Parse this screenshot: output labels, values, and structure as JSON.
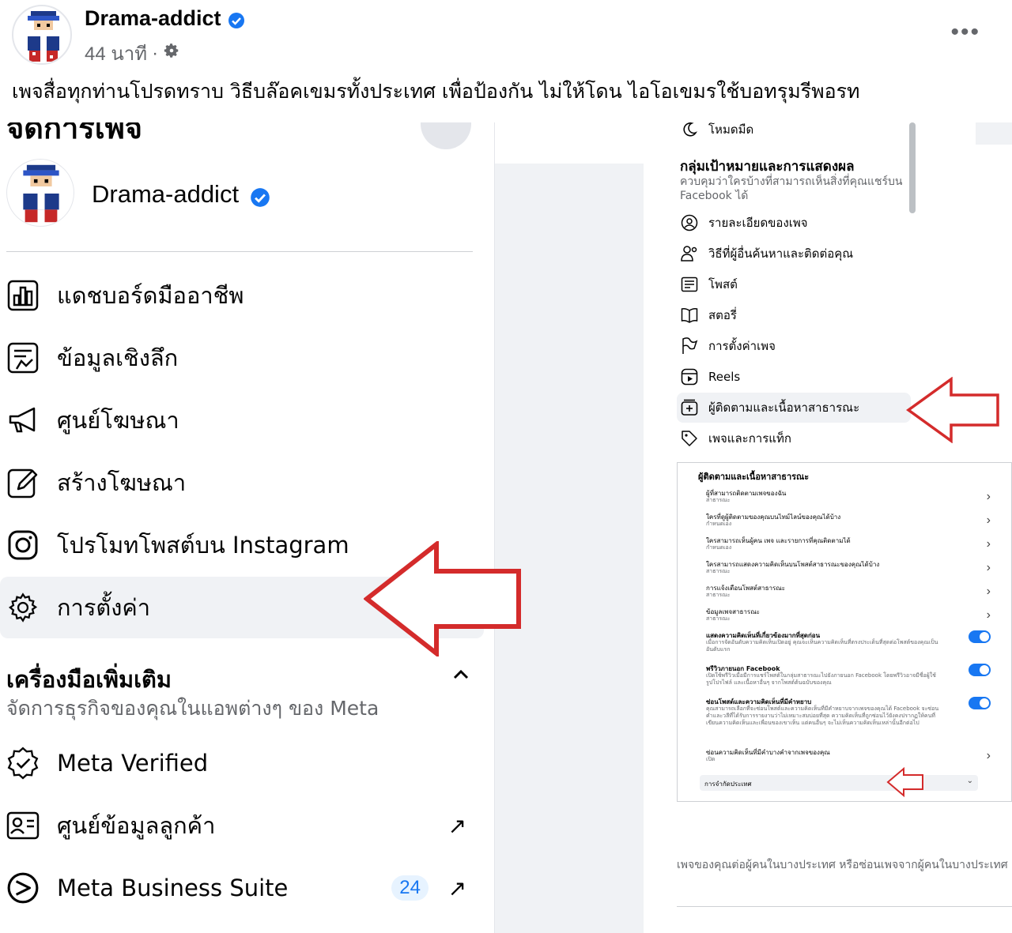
{
  "post": {
    "author": "Drama-addict",
    "time": "44 นาที",
    "separator": "·",
    "text": "เพจสื่อทุกท่านโปรดทราบ วิธีบล๊อคเขมรทั้งประเทศ เพื่อป้องกัน ไม่ให้โดน ไอโอเขมรใช้บอทรุมรีพอรท"
  },
  "left_panel": {
    "title": "จัดการเพจ",
    "page_name": "Drama-addict",
    "menu": [
      {
        "label": "แดชบอร์ดมืออาชีพ",
        "icon": "dashboard-icon"
      },
      {
        "label": "ข้อมูลเชิงลึก",
        "icon": "insights-icon"
      },
      {
        "label": "ศูนย์โฆษณา",
        "icon": "megaphone-icon"
      },
      {
        "label": "สร้างโฆษณา",
        "icon": "pencil-icon"
      },
      {
        "label": "โปรโมทโพสต์บน Instagram",
        "icon": "instagram-icon"
      },
      {
        "label": "การตั้งค่า",
        "icon": "gear-icon"
      }
    ],
    "tools_title": "เครื่องมือเพิ่มเติม",
    "tools_subtitle": "จัดการธุรกิจของคุณในแอพต่างๆ ของ Meta",
    "tools": [
      {
        "label": "Meta Verified",
        "icon": "verified-badge-icon",
        "external": ""
      },
      {
        "label": "ศูนย์ข้อมูลลูกค้า",
        "icon": "contact-card-icon",
        "external": "↗"
      },
      {
        "label": "Meta Business Suite",
        "icon": "meta-business-suite-icon",
        "external": "↗",
        "badge": "24"
      }
    ]
  },
  "settings_menu": {
    "dark_mode": "โหมดมืด",
    "heading": "กลุ่มเป้าหมายและการแสดงผล",
    "description": "ควบคุมว่าใครบ้างที่สามารถเห็นสิ่งที่คุณแชร์บน Facebook ได้",
    "items": [
      {
        "label": "รายละเอียดของเพจ",
        "icon": "profile-icon"
      },
      {
        "label": "วิธีที่ผู้อื่นค้นหาและติดต่อคุณ",
        "icon": "people-icon"
      },
      {
        "label": "โพสต์",
        "icon": "post-icon"
      },
      {
        "label": "สตอรี่",
        "icon": "book-icon"
      },
      {
        "label": "การตั้งค่าเพจ",
        "icon": "flag-icon"
      },
      {
        "label": "Reels",
        "icon": "reels-icon"
      },
      {
        "label": "ผู้ติดตามและเนื้อหาสาธารณะ",
        "icon": "add-box-icon"
      },
      {
        "label": "เพจและการแท็ก",
        "icon": "tag-icon"
      }
    ]
  },
  "followers_panel": {
    "title": "ผู้ติดตามและเนื้อหาสาธารณะ",
    "rows": [
      {
        "title": "ผู้ที่สามารถติดตามเพจของฉัน",
        "sub": "สาธารณะ",
        "control": "chevron"
      },
      {
        "title": "ใครที่ดูผู้ติดตามของคุณบนไทม์ไลน์ของคุณได้บ้าง",
        "sub": "กำหนดเอง",
        "control": "chevron"
      },
      {
        "title": "ใครสามารถเห็นผู้คน เพจ และรายการที่คุณติดตามได้",
        "sub": "กำหนดเอง",
        "control": "chevron"
      },
      {
        "title": "ใครสามารถแสดงความคิดเห็นบนโพสต์สาธารณะของคุณได้บ้าง",
        "sub": "สาธารณะ",
        "control": "chevron"
      },
      {
        "title": "การแจ้งเตือนโพสต์สาธารณะ",
        "sub": "สาธารณะ",
        "control": "chevron"
      },
      {
        "title": "ข้อมูลเพจสาธารณะ",
        "sub": "สาธารณะ",
        "control": "chevron"
      },
      {
        "title": "แสดงความคิดเห็นที่เกี่ยวข้องมากที่สุดก่อน",
        "sub": "เมื่อการจัดอันดับความคิดเห็นเปิดอยู่ คุณจะเห็นความคิดเห็นที่ตรงประเด็นที่สุดต่อโพสต์ของคุณเป็นอันดับแรก",
        "control": "toggle"
      },
      {
        "title": "พรีวิวภายนอก Facebook",
        "sub": "เปิดใช้พรีวิวเมื่อมีการแชร์โพสต์ในกลุ่มสาธารณะไปยังภายนอก Facebook โดยพรีวิวอาจมีชื่อผู้ใช้ รูปโปรไฟล์ และเนื้อหาอื่นๆ จากโพสต์ต้นฉบับของคุณ",
        "control": "toggle"
      },
      {
        "title": "ซ่อนโพสต์และความคิดเห็นที่มีคำหยาบ",
        "sub": "คุณสามารถเลือกที่จะซ่อนโพสต์และความคิดเห็นที่มีคำหยาบจากเพจของคุณได้ Facebook จะซ่อนคำและวลีที่ได้รับการรายงานว่าไม่เหมาะสมบ่อยที่สุด ความคิดเห็นที่ถูกซ่อนไว้ยังคงปรากฏให้คนที่เขียนความคิดเห็นและเพื่อนของเขาเห็น แต่คนอื่นๆ จะไม่เห็นความคิดเห็นเหล่านั้นอีกต่อไป",
        "control": "toggle"
      },
      {
        "title": "ซ่อนความคิดเห็นที่มีคำบางคำจากเพจของคุณ",
        "sub": "เปิด",
        "control": "chevron"
      }
    ],
    "restrict_label": "การจำกัดประเทศ",
    "restrict_icon": "chevron-down-icon"
  },
  "country_description": "เพจของคุณต่อผู้คนในบางประเทศ หรือซ่อนเพจจากผู้คนในบางประเทศ เพจของคุณ",
  "colors": {
    "accent": "#1877f2",
    "arrow_red": "#d42b2b",
    "menu_active": "#f0f2f5"
  }
}
